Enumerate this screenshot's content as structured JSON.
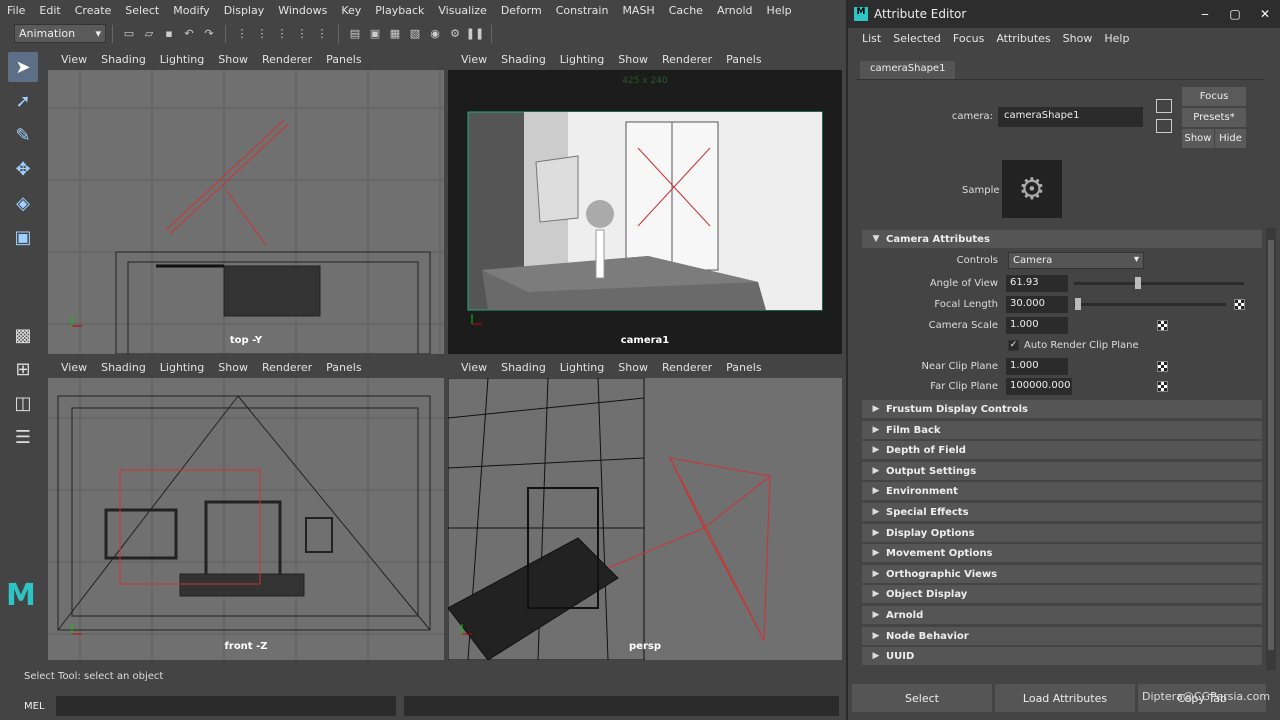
{
  "menubar": {
    "items": [
      "File",
      "Edit",
      "Create",
      "Select",
      "Modify",
      "Display",
      "Windows",
      "Key",
      "Playback",
      "Visualize",
      "Deform",
      "Constrain",
      "MASH",
      "Cache",
      "Arnold",
      "Help"
    ]
  },
  "toolbar": {
    "mode": "Animation"
  },
  "viewports": {
    "menu": [
      "View",
      "Shading",
      "Lighting",
      "Show",
      "Renderer",
      "Panels"
    ],
    "top_label": "top -Y",
    "camera_label": "camera1",
    "camera_resolution": "425 x 240",
    "front_label": "front -Z",
    "persp_label": "persp"
  },
  "status": {
    "help_line": "Select Tool: select an object",
    "mel_label": "MEL"
  },
  "attribute_editor": {
    "title": "Attribute Editor",
    "menu": [
      "List",
      "Selected",
      "Focus",
      "Attributes",
      "Show",
      "Help"
    ],
    "tab": "cameraShape1",
    "camera_label": "camera:",
    "camera_value": "cameraShape1",
    "buttons": {
      "focus": "Focus",
      "presets": "Presets*",
      "show": "Show",
      "hide": "Hide"
    },
    "sample_label": "Sample",
    "camera_attributes": {
      "header": "Camera Attributes",
      "controls_label": "Controls",
      "controls_value": "Camera",
      "angle_of_view_label": "Angle of View",
      "angle_of_view": "61.93",
      "focal_length_label": "Focal Length",
      "focal_length": "30.000",
      "camera_scale_label": "Camera Scale",
      "camera_scale": "1.000",
      "auto_clip_label": "Auto Render Clip Plane",
      "near_clip_label": "Near Clip Plane",
      "near_clip": "1.000",
      "far_clip_label": "Far Clip Plane",
      "far_clip": "100000.000"
    },
    "sections": [
      "Frustum Display Controls",
      "Film Back",
      "Depth of Field",
      "Output Settings",
      "Environment",
      "Special Effects",
      "Display Options",
      "Movement Options",
      "Orthographic Views",
      "Object Display",
      "Arnold",
      "Node Behavior",
      "UUID"
    ],
    "bottom": {
      "select": "Select",
      "load": "Load Attributes",
      "copy": "Copy Tab"
    },
    "watermark": "Diptera@CGPersia.com"
  }
}
